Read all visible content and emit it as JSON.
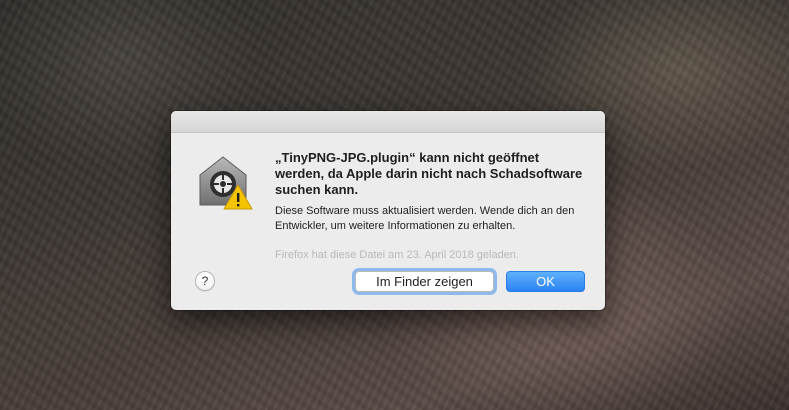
{
  "dialog": {
    "heading": "„TinyPNG-JPG.plugin“ kann nicht geöffnet werden, da Apple darin nicht nach Schadsoftware suchen kann.",
    "message": "Diese Software muss aktualisiert werden. Wende dich an den Entwickler, um weitere Informationen zu erhalten.",
    "origin_note": "Firefox hat diese Datei am 23. April 2018 geladen.",
    "icon": "gatekeeper-warning-icon",
    "help_label": "?",
    "show_in_finder_label": "Im Finder zeigen",
    "ok_label": "OK"
  },
  "colors": {
    "primary_button": "#2b83f1",
    "warning": "#f5c400"
  }
}
